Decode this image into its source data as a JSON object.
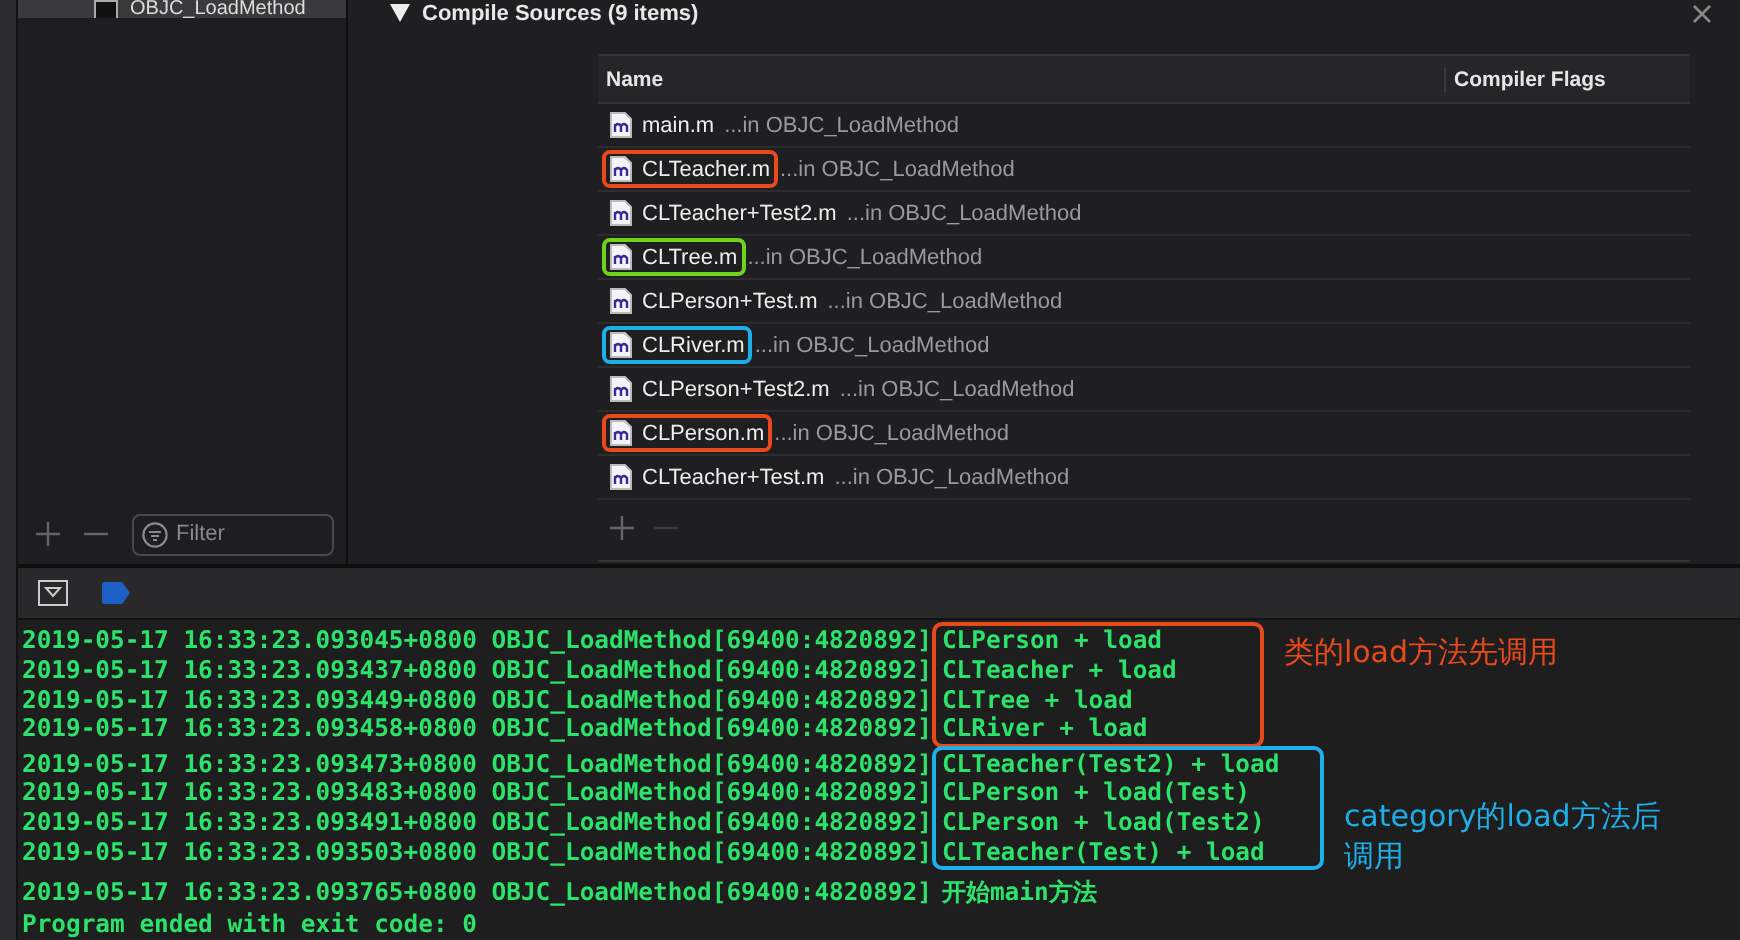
{
  "sidebar": {
    "items": [
      {
        "label": "OBJC_LoadMethod",
        "selected": true
      }
    ],
    "filter": {
      "placeholder": "Filter"
    }
  },
  "section": {
    "title": "Compile Sources (9 items)",
    "expanded": true
  },
  "table": {
    "columns": [
      "Name",
      "Compiler Flags"
    ],
    "rows": [
      {
        "name": "main.m",
        "location": "...in OBJC_LoadMethod"
      },
      {
        "name": "CLTeacher.m",
        "location": "...in OBJC_LoadMethod",
        "color": "#e8491d"
      },
      {
        "name": "CLTeacher+Test2.m",
        "location": "...in OBJC_LoadMethod"
      },
      {
        "name": "CLTree.m",
        "location": "...in OBJC_LoadMethod",
        "color": "#6fd31e"
      },
      {
        "name": "CLPerson+Test.m",
        "location": "...in OBJC_LoadMethod"
      },
      {
        "name": "CLRiver.m",
        "location": "...in OBJC_LoadMethod",
        "color": "#1eaee8"
      },
      {
        "name": "CLPerson+Test2.m",
        "location": "...in OBJC_LoadMethod"
      },
      {
        "name": "CLPerson.m",
        "location": "...in OBJC_LoadMethod",
        "color": "#e8491d"
      },
      {
        "name": "CLTeacher+Test.m",
        "location": "...in OBJC_LoadMethod"
      }
    ]
  },
  "console": {
    "groups": [
      {
        "color": "#e8491d",
        "note": "类的load方法先调用",
        "lines": [
          {
            "prefix": "2019-05-17 16:33:23.093045+0800 OBJC_LoadMethod[69400:4820892]",
            "message": "CLPerson + load"
          },
          {
            "prefix": "2019-05-17 16:33:23.093437+0800 OBJC_LoadMethod[69400:4820892]",
            "message": "CLTeacher + load"
          },
          {
            "prefix": "2019-05-17 16:33:23.093449+0800 OBJC_LoadMethod[69400:4820892]",
            "message": "CLTree + load"
          },
          {
            "prefix": "2019-05-17 16:33:23.093458+0800 OBJC_LoadMethod[69400:4820892]",
            "message": "CLRiver + load"
          }
        ]
      },
      {
        "color": "#1eaee8",
        "note": "category的load方法后调用",
        "lines": [
          {
            "prefix": "2019-05-17 16:33:23.093473+0800 OBJC_LoadMethod[69400:4820892]",
            "message": "CLTeacher(Test2) + load"
          },
          {
            "prefix": "2019-05-17 16:33:23.093483+0800 OBJC_LoadMethod[69400:4820892]",
            "message": "CLPerson + load(Test)"
          },
          {
            "prefix": "2019-05-17 16:33:23.093491+0800 OBJC_LoadMethod[69400:4820892]",
            "message": "CLPerson + load(Test2)"
          },
          {
            "prefix": "2019-05-17 16:33:23.093503+0800 OBJC_LoadMethod[69400:4820892]",
            "message": "CLTeacher(Test) + load"
          }
        ]
      },
      {
        "lines": [
          {
            "prefix": "2019-05-17 16:33:23.093765+0800 OBJC_LoadMethod[69400:4820892]",
            "message": "开始main方法"
          }
        ]
      }
    ],
    "exit_line": "Program ended with exit code: 0"
  }
}
